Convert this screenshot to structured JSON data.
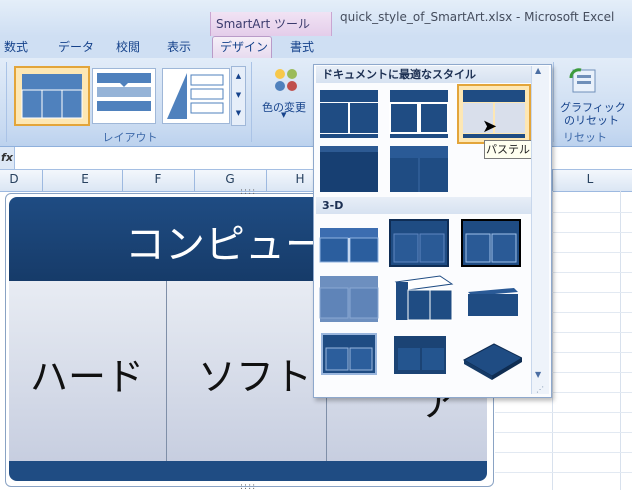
{
  "window": {
    "title": "quick_style_of_SmartArt.xlsx - Microsoft Excel",
    "context_tab_group": "SmartArt ツール"
  },
  "tabs": [
    {
      "label": "数式"
    },
    {
      "label": "データ"
    },
    {
      "label": "校閲"
    },
    {
      "label": "表示"
    },
    {
      "label": "デザイン"
    },
    {
      "label": "書式"
    }
  ],
  "ribbon": {
    "layout_group_label": "レイアウト",
    "change_colors_label": "色の変更",
    "reset_graphic_label_1": "グラフィック",
    "reset_graphic_label_2": "のリセット",
    "reset_group_label": "リセット"
  },
  "formula_bar": {
    "fx": "fx",
    "value": ""
  },
  "columns": [
    "D",
    "E",
    "F",
    "G",
    "H",
    "L"
  ],
  "gallery": {
    "section1_title": "ドキュメントに最適なスタイル",
    "section2_title": "3-D",
    "tooltip": "パステル",
    "selected_index": 2
  },
  "smartart": {
    "title": "コンピュー",
    "boxes": [
      "ハード",
      "ソフト",
      "ア"
    ]
  },
  "colors": {
    "accent_dark": "#1f4c83",
    "ribbon_blue": "#c8daf1",
    "selected_border": "#e3a53a"
  }
}
